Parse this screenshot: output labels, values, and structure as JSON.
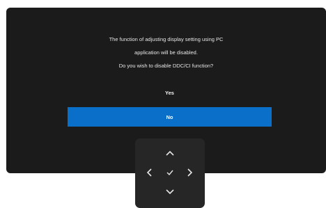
{
  "dialog": {
    "message_lines": [
      "The function of adjusting display setting using PC",
      "application will be disabled.",
      "Do you wish to disable DDC/CI function?"
    ],
    "options": {
      "yes": "Yes",
      "no": "No"
    },
    "selected_option": "No"
  },
  "joystick": {
    "controls": [
      "up",
      "left",
      "confirm",
      "right",
      "down"
    ],
    "icons": {
      "up": "chevron-up-icon",
      "left": "chevron-left-icon",
      "confirm": "check-icon",
      "right": "chevron-right-icon",
      "down": "chevron-down-icon"
    }
  },
  "colors": {
    "panel_background": "#1b1b1b",
    "highlight": "#0a6fc9",
    "joystick_background": "#262626"
  }
}
